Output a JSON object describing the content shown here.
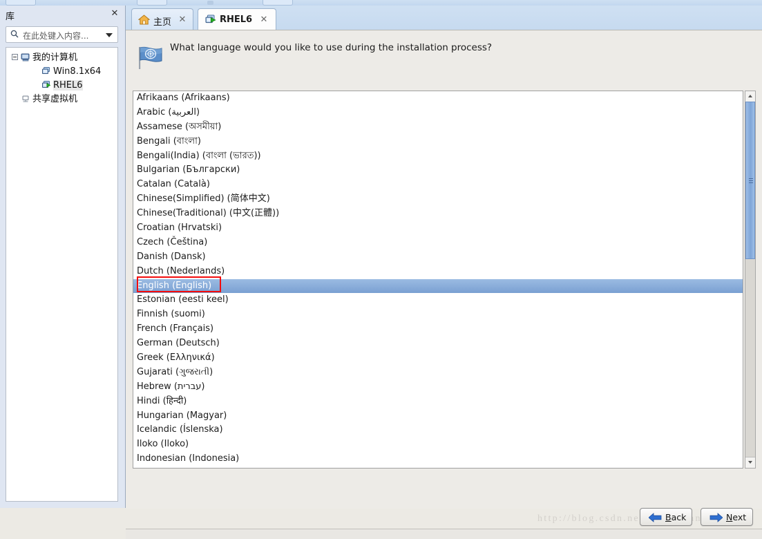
{
  "window": {
    "library_panel": {
      "title": "库",
      "close_icon": "close-icon",
      "search_placeholder": "在此处键入内容...",
      "search_value": "",
      "tree": [
        {
          "label": "我的计算机",
          "level": 0,
          "icon": "my-computer-icon",
          "expanded": true,
          "selected": false
        },
        {
          "label": "Win8.1x64",
          "level": 1,
          "icon": "virtual-machine-icon",
          "selected": false,
          "running": false
        },
        {
          "label": "RHEL6",
          "level": 1,
          "icon": "virtual-machine-running-icon",
          "selected": true,
          "running": true
        },
        {
          "label": "共享虚拟机",
          "level": 0,
          "icon": "shared-vms-icon",
          "expanded": false,
          "selected": false
        }
      ]
    },
    "tabs": [
      {
        "label": "主页",
        "icon": "home-icon",
        "active": false,
        "close_icon": "close-icon"
      },
      {
        "label": "RHEL6",
        "icon": "virtual-machine-running-icon",
        "active": true,
        "close_icon": "close-icon"
      }
    ]
  },
  "installer": {
    "flag_icon": "un-flag-icon",
    "prompt": "What language would you like to use during the installation process?",
    "languages": [
      "Afrikaans (Afrikaans)",
      "Arabic (العربية)",
      "Assamese (অসমীয়া)",
      "Bengali (বাংলা)",
      "Bengali(India) (বাংলা (ভারত))",
      "Bulgarian (Български)",
      "Catalan (Català)",
      "Chinese(Simplified) (简体中文)",
      "Chinese(Traditional) (中文(正體))",
      "Croatian (Hrvatski)",
      "Czech (Čeština)",
      "Danish (Dansk)",
      "Dutch (Nederlands)",
      "English (English)",
      "Estonian (eesti keel)",
      "Finnish (suomi)",
      "French (Français)",
      "German (Deutsch)",
      "Greek (Ελληνικά)",
      "Gujarati (ગુજરાતી)",
      "Hebrew (עברית)",
      "Hindi (हिन्दी)",
      "Hungarian (Magyar)",
      "Icelandic (Íslenska)",
      "Iloko (Iloko)",
      "Indonesian (Indonesia)"
    ],
    "selected_language": "English (English)",
    "selected_index": 13,
    "scrollbar": {
      "up_arrow_icon": "scroll-up-icon",
      "down_arrow_icon": "scroll-down-icon",
      "thumb_position_percent": 0,
      "thumb_size_percent": 43
    },
    "buttons": {
      "back": {
        "label_prefix": "",
        "accel": "B",
        "label_rest": "ack",
        "icon": "arrow-left-icon"
      },
      "next": {
        "label_prefix": "",
        "accel": "N",
        "label_rest": "ext",
        "icon": "arrow-right-icon"
      }
    }
  },
  "watermark": "http://blog.csdn.net/ice_banana",
  "colors": {
    "selection_blue": "#7aa0d2",
    "annotation_red": "#f30c0c",
    "tabbar_blue": "#c6daf0",
    "panel_grey": "#edebe7"
  }
}
